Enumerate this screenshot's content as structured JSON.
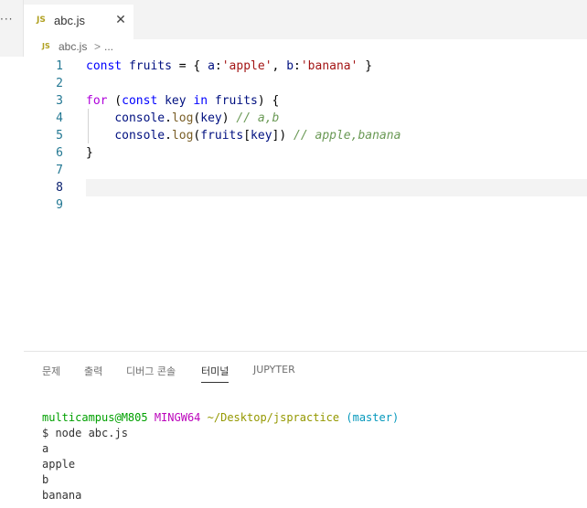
{
  "tabbar": {
    "overflow_label": "···",
    "active_tab": {
      "icon_label": "JS",
      "label": "abc.js",
      "close_glyph": "✕"
    }
  },
  "breadcrumb": {
    "icon_label": "JS",
    "file": "abc.js",
    "separator": ">",
    "more": "..."
  },
  "editor": {
    "lines": [
      {
        "number": "1",
        "tokens": [
          {
            "t": "const",
            "c": "kw"
          },
          {
            "t": " ",
            "c": "plain"
          },
          {
            "t": "fruits",
            "c": "var"
          },
          {
            "t": " = { ",
            "c": "plain"
          },
          {
            "t": "a",
            "c": "var"
          },
          {
            "t": ":",
            "c": "plain"
          },
          {
            "t": "'apple'",
            "c": "str"
          },
          {
            "t": ", ",
            "c": "plain"
          },
          {
            "t": "b",
            "c": "var"
          },
          {
            "t": ":",
            "c": "plain"
          },
          {
            "t": "'banana'",
            "c": "str"
          },
          {
            "t": " }",
            "c": "plain"
          }
        ]
      },
      {
        "number": "2",
        "tokens": []
      },
      {
        "number": "3",
        "tokens": [
          {
            "t": "for",
            "c": "ctl"
          },
          {
            "t": " (",
            "c": "plain"
          },
          {
            "t": "const",
            "c": "kw"
          },
          {
            "t": " ",
            "c": "plain"
          },
          {
            "t": "key",
            "c": "var"
          },
          {
            "t": " ",
            "c": "plain"
          },
          {
            "t": "in",
            "c": "kw"
          },
          {
            "t": " ",
            "c": "plain"
          },
          {
            "t": "fruits",
            "c": "var"
          },
          {
            "t": ") {",
            "c": "plain"
          }
        ]
      },
      {
        "number": "4",
        "tokens": [
          {
            "t": "    ",
            "c": "plain"
          },
          {
            "t": "console",
            "c": "var"
          },
          {
            "t": ".",
            "c": "plain"
          },
          {
            "t": "log",
            "c": "fn"
          },
          {
            "t": "(",
            "c": "plain"
          },
          {
            "t": "key",
            "c": "var"
          },
          {
            "t": ") ",
            "c": "plain"
          },
          {
            "t": "// a,b",
            "c": "cmt"
          }
        ]
      },
      {
        "number": "5",
        "tokens": [
          {
            "t": "    ",
            "c": "plain"
          },
          {
            "t": "console",
            "c": "var"
          },
          {
            "t": ".",
            "c": "plain"
          },
          {
            "t": "log",
            "c": "fn"
          },
          {
            "t": "(",
            "c": "plain"
          },
          {
            "t": "fruits",
            "c": "var"
          },
          {
            "t": "[",
            "c": "plain"
          },
          {
            "t": "key",
            "c": "var"
          },
          {
            "t": "]) ",
            "c": "plain"
          },
          {
            "t": "// apple,banana",
            "c": "cmt"
          }
        ]
      },
      {
        "number": "6",
        "tokens": [
          {
            "t": "}",
            "c": "plain"
          }
        ]
      },
      {
        "number": "7",
        "tokens": []
      },
      {
        "number": "8",
        "tokens": [],
        "current": true
      },
      {
        "number": "9",
        "tokens": []
      }
    ]
  },
  "panel": {
    "tabs": [
      {
        "label": "문제",
        "active": false
      },
      {
        "label": "출력",
        "active": false
      },
      {
        "label": "디버그 콘솔",
        "active": false
      },
      {
        "label": "터미널",
        "active": true
      },
      {
        "label": "JUPYTER",
        "active": false
      }
    ],
    "terminal": {
      "prompt_user": "multicampus@M805",
      "prompt_env": "MINGW64",
      "prompt_path": "~/Desktop/jspractice",
      "prompt_branch": "(master)",
      "command": "$ node abc.js",
      "output": [
        "a",
        "apple",
        "b",
        "banana"
      ]
    }
  },
  "colors": {
    "keyword": "#0000ff",
    "control": "#af00db",
    "variable": "#001080",
    "string": "#a31515",
    "function": "#795e26",
    "comment": "#6a9955",
    "line_number": "#237893"
  }
}
